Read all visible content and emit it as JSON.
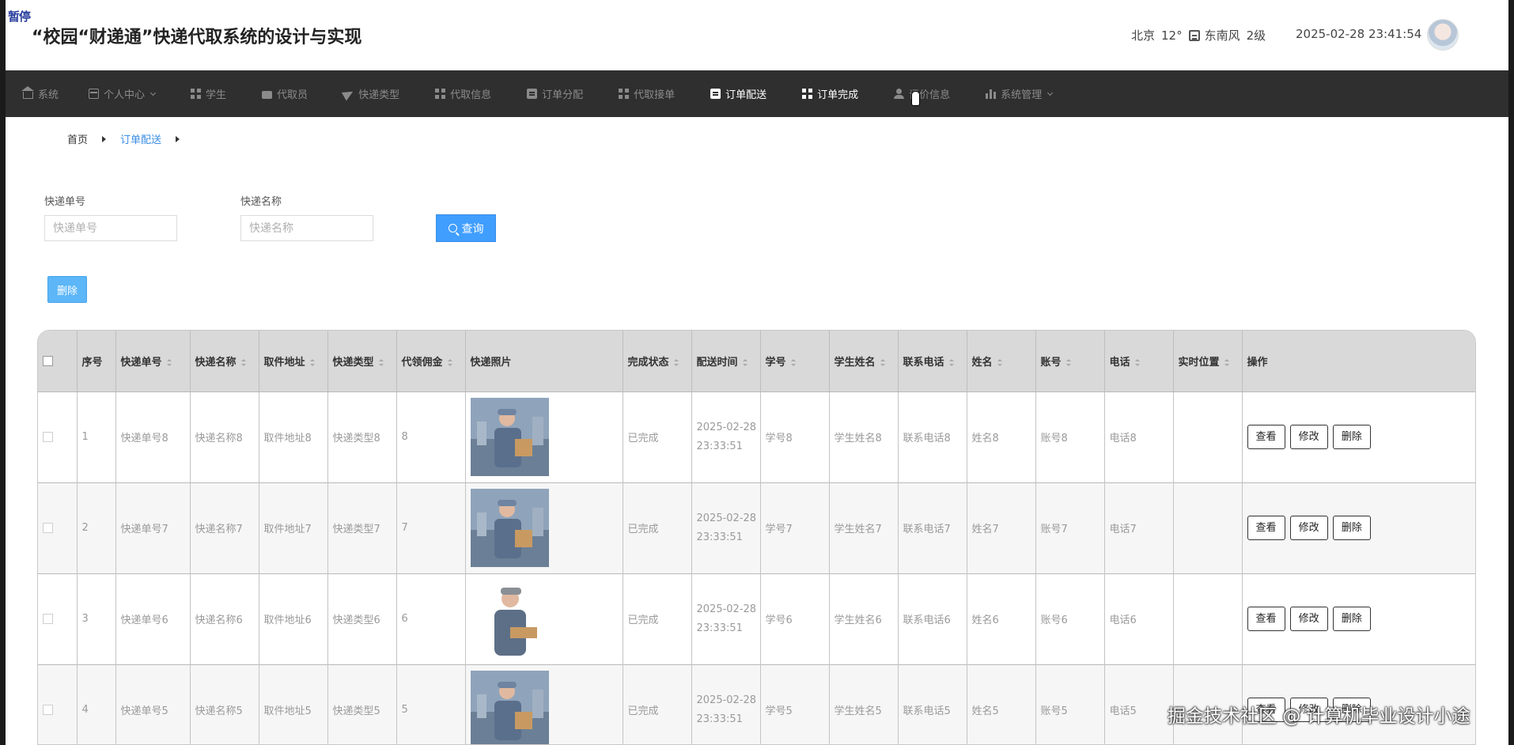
{
  "overlay": {
    "pause_label": "暂停"
  },
  "header": {
    "title": "“校园“财递通”快递代取系统的设计与实现",
    "weather": {
      "city": "北京",
      "temp": "12°",
      "wind": "东南风",
      "level": "2级"
    },
    "datetime": "2025-02-28 23:41:54"
  },
  "nav": {
    "items": [
      {
        "label": "系统",
        "icon": "home-icon",
        "active": false
      },
      {
        "label": "个人中心",
        "icon": "box-icon",
        "active": false,
        "dropdown": true
      },
      {
        "label": "学生",
        "icon": "grid-icon",
        "active": false
      },
      {
        "label": "代取员",
        "icon": "bag-icon",
        "active": false
      },
      {
        "label": "快递类型",
        "icon": "send-icon",
        "active": false
      },
      {
        "label": "代取信息",
        "icon": "grid-icon",
        "active": false
      },
      {
        "label": "订单分配",
        "icon": "clipboard-icon",
        "active": false
      },
      {
        "label": "代取接单",
        "icon": "grid-icon",
        "active": false
      },
      {
        "label": "订单配送",
        "icon": "clipboard-icon",
        "active": true
      },
      {
        "label": "订单完成",
        "icon": "grid-icon",
        "active": true
      },
      {
        "label": "评价信息",
        "icon": "user-icon",
        "active": false
      },
      {
        "label": "系统管理",
        "icon": "bars-icon",
        "active": false,
        "dropdown": true
      }
    ]
  },
  "breadcrumb": {
    "home": "首页",
    "current": "订单配送"
  },
  "search": {
    "field1_label": "快递单号",
    "field1_placeholder": "快递单号",
    "field2_label": "快递名称",
    "field2_placeholder": "快递名称",
    "query_label": "查询"
  },
  "toolbar": {
    "delete_label": "删除"
  },
  "table": {
    "columns": [
      "序号",
      "快递单号",
      "快递名称",
      "取件地址",
      "快递类型",
      "代领佣金",
      "快递照片",
      "完成状态",
      "配送时间",
      "学号",
      "学生姓名",
      "联系电话",
      "姓名",
      "账号",
      "电话",
      "实时位置",
      "操作"
    ],
    "actions": {
      "view": "查看",
      "edit": "修改",
      "delete": "删除"
    },
    "rows": [
      {
        "index": "1",
        "tracking": "快递单号8",
        "name": "快递名称8",
        "address": "取件地址8",
        "type": "快递类型8",
        "fee": "8",
        "status": "已完成",
        "time": "2025-02-28 23:33:51",
        "student_id": "学号8",
        "student_name": "学生姓名8",
        "contact": "联系电话8",
        "courier_name": "姓名8",
        "account": "账号8",
        "phone": "电话8",
        "location": ""
      },
      {
        "index": "2",
        "tracking": "快递单号7",
        "name": "快递名称7",
        "address": "取件地址7",
        "type": "快递类型7",
        "fee": "7",
        "status": "已完成",
        "time": "2025-02-28 23:33:51",
        "student_id": "学号7",
        "student_name": "学生姓名7",
        "contact": "联系电话7",
        "courier_name": "姓名7",
        "account": "账号7",
        "phone": "电话7",
        "location": ""
      },
      {
        "index": "3",
        "tracking": "快递单号6",
        "name": "快递名称6",
        "address": "取件地址6",
        "type": "快递类型6",
        "fee": "6",
        "status": "已完成",
        "time": "2025-02-28 23:33:51",
        "student_id": "学号6",
        "student_name": "学生姓名6",
        "contact": "联系电话6",
        "courier_name": "姓名6",
        "account": "账号6",
        "phone": "电话6",
        "location": ""
      },
      {
        "index": "4",
        "tracking": "快递单号5",
        "name": "快递名称5",
        "address": "取件地址5",
        "type": "快递类型5",
        "fee": "5",
        "status": "已完成",
        "time": "2025-02-28 23:33:51",
        "student_id": "学号5",
        "student_name": "学生姓名5",
        "contact": "联系电话5",
        "courier_name": "姓名5",
        "account": "账号5",
        "phone": "电话5",
        "location": ""
      }
    ]
  },
  "watermark": "掘金技术社区 @ 计算机毕业设计小途",
  "colors": {
    "nav_bg": "#2f2f2f",
    "accent": "#409eff",
    "header_row": "#d9d9d9"
  }
}
